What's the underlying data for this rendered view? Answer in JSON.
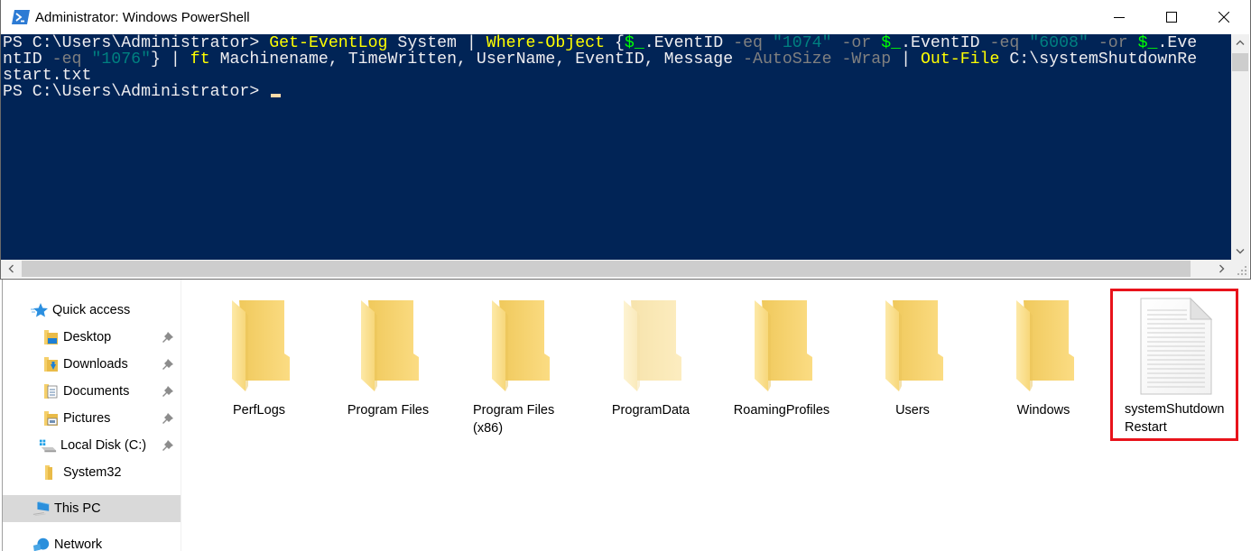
{
  "powershell": {
    "title": "Administrator: Windows PowerShell",
    "title_icon": "powershell-icon",
    "controls": {
      "minimize": "minimize-icon",
      "maximize": "maximize-icon",
      "close": "close-icon"
    },
    "console": {
      "lines": [
        [
          {
            "t": "plain",
            "s": "PS C:\\Users\\Administrator> "
          },
          {
            "t": "cmd",
            "s": "Get-EventLog"
          },
          {
            "t": "plain",
            "s": " System | "
          },
          {
            "t": "cmd",
            "s": "Where-Object"
          },
          {
            "t": "plain",
            "s": " {"
          },
          {
            "t": "var",
            "s": "$_"
          },
          {
            "t": "plain",
            "s": ".EventID "
          },
          {
            "t": "param",
            "s": "-eq"
          },
          {
            "t": "plain",
            "s": " "
          },
          {
            "t": "str",
            "s": "\"1074\""
          },
          {
            "t": "plain",
            "s": " "
          },
          {
            "t": "param",
            "s": "-or"
          },
          {
            "t": "plain",
            "s": " "
          },
          {
            "t": "var",
            "s": "$_"
          },
          {
            "t": "plain",
            "s": ".EventID "
          },
          {
            "t": "param",
            "s": "-eq"
          },
          {
            "t": "plain",
            "s": " "
          },
          {
            "t": "str",
            "s": "\"6008\""
          },
          {
            "t": "plain",
            "s": " "
          },
          {
            "t": "param",
            "s": "-or"
          },
          {
            "t": "plain",
            "s": " "
          },
          {
            "t": "var",
            "s": "$_"
          },
          {
            "t": "plain",
            "s": ".Eve"
          }
        ],
        [
          {
            "t": "plain",
            "s": "ntID "
          },
          {
            "t": "param",
            "s": "-eq"
          },
          {
            "t": "plain",
            "s": " "
          },
          {
            "t": "str",
            "s": "\"1076\""
          },
          {
            "t": "plain",
            "s": "} | "
          },
          {
            "t": "cmd",
            "s": "ft"
          },
          {
            "t": "plain",
            "s": " Machinename, TimeWritten, UserName, EventID, Message "
          },
          {
            "t": "param",
            "s": "-AutoSize"
          },
          {
            "t": "plain",
            "s": " "
          },
          {
            "t": "param",
            "s": "-Wrap"
          },
          {
            "t": "plain",
            "s": " | "
          },
          {
            "t": "cmd",
            "s": "Out-File"
          },
          {
            "t": "plain",
            "s": " C:\\systemShutdownRe"
          }
        ],
        [
          {
            "t": "plain",
            "s": "start.txt"
          }
        ],
        [
          {
            "t": "plain",
            "s": "PS C:\\Users\\Administrator> "
          },
          {
            "t": "cursor",
            "s": ""
          }
        ]
      ]
    },
    "colors": {
      "background": "#012456",
      "foreground": "#eeedf0",
      "command": "#ffff00",
      "parameter": "#808080",
      "string": "#008080",
      "variable": "#00ff00",
      "cursor": "#fedba9"
    }
  },
  "explorer": {
    "nav": {
      "items": [
        {
          "label": "Quick access",
          "icon": "quick-access-star-icon",
          "pinned": false
        },
        {
          "label": "Desktop",
          "icon": "desktop-folder-icon",
          "pinned": true
        },
        {
          "label": "Downloads",
          "icon": "downloads-folder-icon",
          "pinned": true
        },
        {
          "label": "Documents",
          "icon": "documents-folder-icon",
          "pinned": true
        },
        {
          "label": "Pictures",
          "icon": "pictures-folder-icon",
          "pinned": true
        },
        {
          "label": "Local Disk (C:)",
          "icon": "local-disk-icon",
          "pinned": true
        },
        {
          "label": "System32",
          "icon": "folder-icon",
          "pinned": false
        },
        {
          "label": "This PC",
          "icon": "this-pc-icon",
          "pinned": false,
          "selected": true
        },
        {
          "label": "Network",
          "icon": "network-icon",
          "pinned": false
        }
      ]
    },
    "items": [
      {
        "label": "PerfLogs",
        "type": "folder"
      },
      {
        "label": "Program Files",
        "type": "folder"
      },
      {
        "label": "Program Files (x86)",
        "label_lines": [
          "Program Files",
          "(x86)"
        ],
        "type": "folder"
      },
      {
        "label": "ProgramData",
        "type": "folder",
        "hidden": true
      },
      {
        "label": "RoamingProfiles",
        "type": "folder"
      },
      {
        "label": "Users",
        "type": "folder"
      },
      {
        "label": "Windows",
        "type": "folder"
      },
      {
        "label": "systemShutdownRestart",
        "label_lines": [
          "systemShutdown",
          "Restart"
        ],
        "type": "text-file",
        "highlighted": true
      }
    ],
    "highlight_color": "#e8131b"
  }
}
